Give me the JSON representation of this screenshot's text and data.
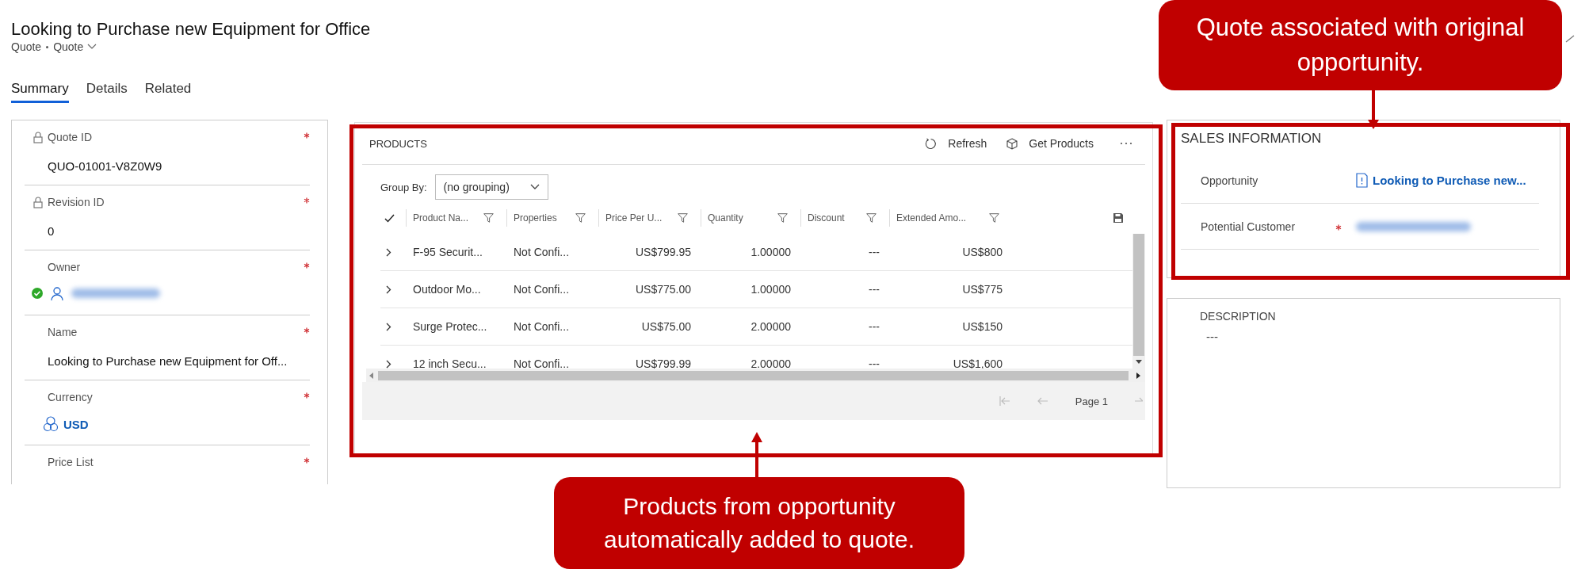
{
  "header": {
    "title": "Looking to Purchase new Equipment for Office",
    "entity": "Quote",
    "form": "Quote"
  },
  "tabs": [
    {
      "label": "Summary",
      "selected": true
    },
    {
      "label": "Details",
      "selected": false
    },
    {
      "label": "Related",
      "selected": false
    }
  ],
  "summary_fields": [
    {
      "label": "Quote ID",
      "locked": true,
      "required": true,
      "kind": "text",
      "value": "QUO-01001-V8Z0W9"
    },
    {
      "label": "Revision ID",
      "locked": true,
      "required": true,
      "kind": "text",
      "value": "0"
    },
    {
      "label": "Owner",
      "locked": false,
      "required": true,
      "kind": "user"
    },
    {
      "label": "Name",
      "locked": false,
      "required": true,
      "kind": "text",
      "value": "Looking to Purchase new Equipment for Off..."
    },
    {
      "label": "Currency",
      "locked": false,
      "required": true,
      "kind": "currency",
      "value": "USD"
    },
    {
      "label": "Price List",
      "locked": false,
      "required": true,
      "kind": "empty"
    }
  ],
  "products": {
    "title": "PRODUCTS",
    "commands": [
      {
        "label": "Refresh",
        "kind": "refresh"
      },
      {
        "label": "Get Products",
        "kind": "box"
      }
    ],
    "group_by": {
      "label": "Group By:",
      "value": "(no grouping)"
    },
    "columns": [
      "Product Na...",
      "Properties",
      "Price Per U...",
      "Quantity",
      "Discount",
      "Extended Amo..."
    ],
    "rows": [
      [
        "F-95 Securit...",
        "Not Confi...",
        "US$799.95",
        "1.00000",
        "---",
        "US$800"
      ],
      [
        "Outdoor Mo...",
        "Not Confi...",
        "US$775.00",
        "1.00000",
        "---",
        "US$775"
      ],
      [
        "Surge Protec...",
        "Not Confi...",
        "US$75.00",
        "2.00000",
        "---",
        "US$150"
      ],
      [
        "12 inch Secu...",
        "Not Confi...",
        "US$799.99",
        "2.00000",
        "---",
        "US$1,600"
      ]
    ],
    "pager": "Page 1"
  },
  "sales_information": {
    "title": "SALES INFORMATION",
    "fields": [
      {
        "label": "Opportunity",
        "required": false,
        "kind": "link",
        "value": "Looking to Purchase new..."
      },
      {
        "label": "Potential Customer",
        "required": true,
        "kind": "blurred"
      }
    ]
  },
  "description": {
    "title": "DESCRIPTION",
    "value": "---"
  },
  "callouts": [
    {
      "text": "Quote associated with original opportunity.",
      "kind": "top"
    },
    {
      "text": "Products from opportunity automatically added to quote.",
      "kind": "bottom"
    }
  ]
}
